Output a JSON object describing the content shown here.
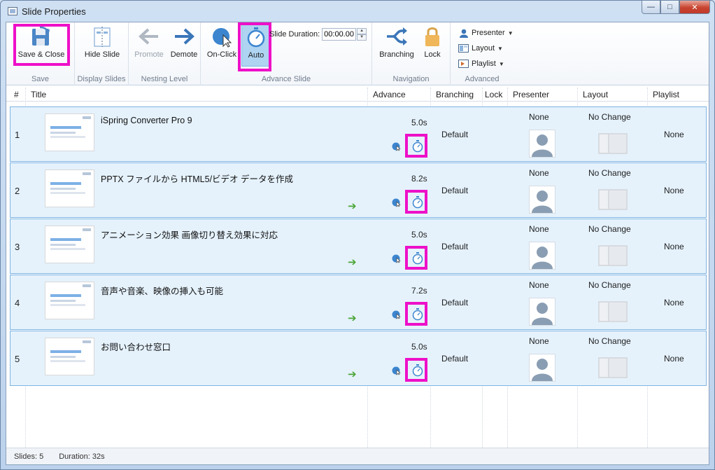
{
  "window": {
    "title": "Slide Properties",
    "minimize": "—",
    "maximize": "□",
    "close": "✕"
  },
  "ribbon": {
    "save_close": "Save & Close",
    "hide_slide": "Hide Slide",
    "promote": "Promote",
    "demote": "Demote",
    "on_click": "On-Click",
    "auto": "Auto",
    "slide_duration_label": "Slide Duration:",
    "slide_duration_value": "00:00.00",
    "branching": "Branching",
    "lock": "Lock",
    "presenter": "Presenter",
    "layout": "Layout",
    "playlist": "Playlist",
    "groups": {
      "save": "Save",
      "display": "Display Slides",
      "nesting": "Nesting Level",
      "advance": "Advance Slide",
      "navigation": "Navigation",
      "advanced": "Advanced"
    }
  },
  "columns": [
    "#",
    "Title",
    "Advance",
    "Branching",
    "Lock",
    "Presenter",
    "Layout",
    "Playlist"
  ],
  "rows": [
    {
      "num": "1",
      "title": "iSpring Converter Pro 9",
      "time": "5.0s",
      "branching": "Default",
      "presenter": "None",
      "layout": "No Change",
      "playlist": "None",
      "arrow": false
    },
    {
      "num": "2",
      "title": "PPTX ファイルから HTML5/ビデオ データを作成",
      "time": "8.2s",
      "branching": "Default",
      "presenter": "None",
      "layout": "No Change",
      "playlist": "None",
      "arrow": true
    },
    {
      "num": "3",
      "title": "アニメーション効果 画像切り替え効果に対応",
      "time": "5.0s",
      "branching": "Default",
      "presenter": "None",
      "layout": "No Change",
      "playlist": "None",
      "arrow": true
    },
    {
      "num": "4",
      "title": "音声や音楽、映像の挿入も可能",
      "time": "7.2s",
      "branching": "Default",
      "presenter": "None",
      "layout": "No Change",
      "playlist": "None",
      "arrow": true
    },
    {
      "num": "5",
      "title": "お問い合わせ窓口",
      "time": "5.0s",
      "branching": "Default",
      "presenter": "None",
      "layout": "No Change",
      "playlist": "None",
      "arrow": true
    }
  ],
  "status": {
    "slides": "Slides: 5",
    "duration": "Duration: 32s"
  },
  "colors": {
    "highlight": "#ee10c8",
    "row_bg": "#e5f2fc",
    "row_border": "#7fb4e2",
    "accent": "#3a82c9"
  }
}
